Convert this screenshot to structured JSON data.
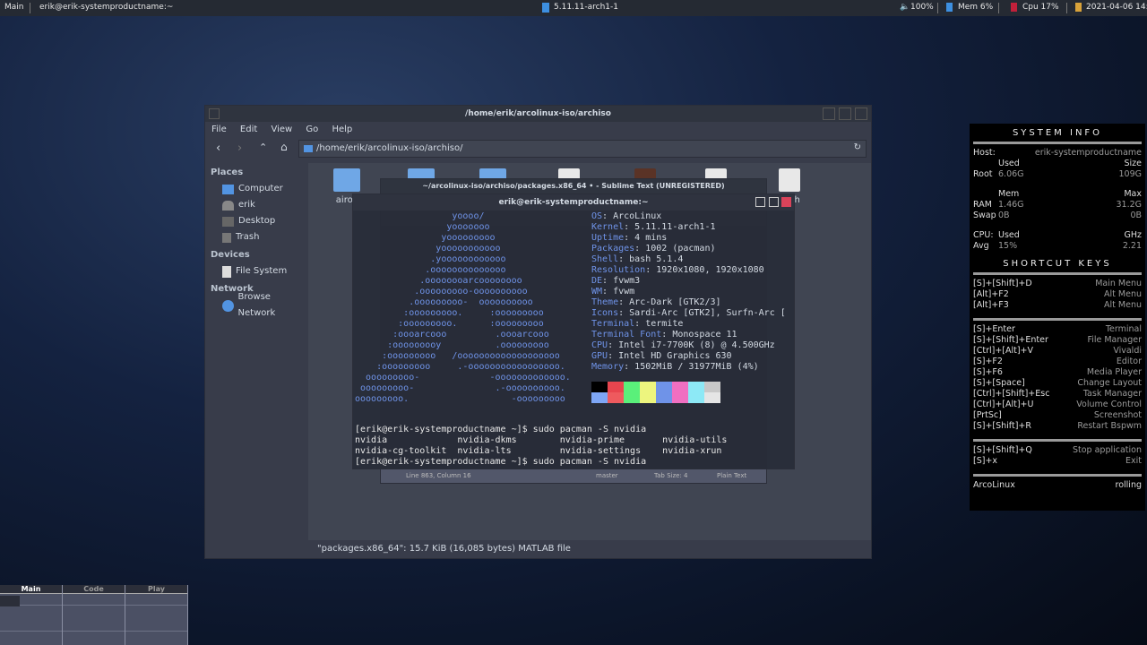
{
  "topbar": {
    "workspace": "Main",
    "window_title": "erik@erik-systemproductname:~",
    "kernel": "5.11.11-arch1-1",
    "volume": "100%",
    "mem": "Mem 6%",
    "cpu": "Cpu  17%",
    "datetime": "2021-04-06 14:06"
  },
  "file_manager": {
    "title": "/home/erik/arcolinux-iso/archiso",
    "menu": [
      "File",
      "Edit",
      "View",
      "Go",
      "Help"
    ],
    "path": "/home/erik/arcolinux-iso/archiso/",
    "sidebar": {
      "places_header": "Places",
      "places": [
        "Computer",
        "erik",
        "Desktop",
        "Trash"
      ],
      "devices_header": "Devices",
      "devices": [
        "File System"
      ],
      "network_header": "Network",
      "network": [
        "Browse Network"
      ]
    },
    "files": [
      {
        "type": "folder",
        "label": "airoc"
      },
      {
        "type": "folder",
        "label": ""
      },
      {
        "type": "folder",
        "label": ""
      },
      {
        "type": "file",
        "label": ""
      },
      {
        "type": "file-brown",
        "label": ""
      },
      {
        "type": "file",
        "label": ""
      },
      {
        "type": "script",
        "label": "ef.sh"
      }
    ],
    "status": "\"packages.x86_64\": 15.7 KiB (16,085 bytes) MATLAB file"
  },
  "sublime": {
    "title": "~/arcolinux-iso/archiso/packages.x86_64 • - Sublime Text (UNREGISTERED)",
    "status_position": "Line 863, Column 16",
    "status_branch": "master",
    "status_tab": "Tab Size: 4",
    "status_syntax": "Plain Text"
  },
  "terminal": {
    "title": "erik@erik-systemproductname:~",
    "ascii": [
      "                  yoooo/",
      "                 yooooooo",
      "                yooooooooo",
      "               yooooooooooo",
      "              .yoooooooooooo",
      "             .oooooooooooooo",
      "            .oooooooarcoooooooo",
      "           .ooooooooo-oooooooooo",
      "          .ooooooooo-  oooooooooo",
      "         :ooooooooo.     :ooooooooo",
      "        :ooooooooo.      :ooooooooo",
      "       :oooarcooo         .oooarcooo",
      "      :ooooooooy          .ooooooooo",
      "     :ooooooooo   /ooooooooooooooooooo",
      "    :ooooooooo     .-ooooooooooooooooo.",
      "  ooooooooo-             -ooooooooooooo.",
      " ooooooooo-               .-oooooooooo.",
      "ooooooooo.                   -ooooooooo"
    ],
    "info": [
      {
        "k": "OS",
        "v": "ArcoLinux"
      },
      {
        "k": "Kernel",
        "v": "5.11.11-arch1-1"
      },
      {
        "k": "Uptime",
        "v": "4 mins"
      },
      {
        "k": "Packages",
        "v": "1002 (pacman)"
      },
      {
        "k": "Shell",
        "v": "bash 5.1.4"
      },
      {
        "k": "Resolution",
        "v": "1920x1080, 1920x1080"
      },
      {
        "k": "DE",
        "v": "fvwm3"
      },
      {
        "k": "WM",
        "v": "fvwm"
      },
      {
        "k": "Theme",
        "v": "Arc-Dark [GTK2/3]"
      },
      {
        "k": "Icons",
        "v": "Sardi-Arc [GTK2], Surfn-Arc ["
      },
      {
        "k": "Terminal",
        "v": "termite"
      },
      {
        "k": "Terminal Font",
        "v": "Monospace 11"
      },
      {
        "k": "CPU",
        "v": "Intel i7-7700K (8) @ 4.500GHz"
      },
      {
        "k": "GPU",
        "v": "Intel HD Graphics 630"
      },
      {
        "k": "Memory",
        "v": "1502MiB / 31977MiB (4%)"
      }
    ],
    "palette_top": [
      "#000000",
      "#e8454e",
      "#5af07a",
      "#edf57e",
      "#6f93e8",
      "#f06fc1",
      "#8de9f6",
      "#c8c8c8"
    ],
    "palette_bottom": [
      "#7ea6f5",
      "#ee5a5e",
      "#5af07a",
      "#edf57e",
      "#6f93e8",
      "#f06fc1",
      "#8de9f6",
      "#e5e5e5"
    ],
    "lines": [
      "[erik@erik-systemproductname ~]$ sudo pacman -S nvidia",
      "nvidia             nvidia-dkms        nvidia-prime       nvidia-utils",
      "nvidia-cg-toolkit  nvidia-lts         nvidia-settings    nvidia-xrun",
      "[erik@erik-systemproductname ~]$ sudo pacman -S nvidia"
    ]
  },
  "conky": {
    "title": "SYSTEM INFO",
    "host_label": "Host:",
    "host": "erik-systemproductname",
    "rows": [
      [
        "",
        "Used",
        "Size"
      ],
      [
        "Root",
        "6.06G",
        "109G"
      ],
      null,
      [
        "",
        "Mem",
        "Max"
      ],
      [
        "RAM",
        "1.46G",
        "31.2G"
      ],
      [
        "Swap",
        "0B",
        "0B"
      ],
      null,
      [
        "CPU:",
        "Used",
        "GHz"
      ],
      [
        "Avg",
        "  15%",
        "2.21"
      ]
    ],
    "shortcuts_title": "SHORTCUT KEYS",
    "groups": [
      [
        [
          "[S]+[Shift]+D",
          "Main Menu"
        ],
        [
          "[Alt]+F2",
          "Alt Menu"
        ],
        [
          "[Alt]+F3",
          "Alt Menu"
        ]
      ],
      [
        [
          "[S]+Enter",
          "Terminal"
        ],
        [
          "[S]+[Shift]+Enter",
          "File Manager"
        ],
        [
          "[Ctrl]+[Alt]+V",
          "Vivaldi"
        ],
        [
          "[S]+F2",
          "Editor"
        ],
        [
          "[S]+F6",
          "Media Player"
        ],
        [
          "[S]+[Space]",
          "Change Layout"
        ],
        [
          "[Ctrl]+[Shift]+Esc",
          "Task Manager"
        ],
        [
          "[Ctrl]+[Alt]+U",
          "Volume Control"
        ],
        [
          "[PrtSc]",
          "Screenshot"
        ],
        [
          "[S]+[Shift]+R",
          "Restart Bspwm"
        ]
      ],
      [
        [
          "[S]+[Shift]+Q",
          "Stop application"
        ],
        [
          "[S]+x",
          "Exit"
        ]
      ]
    ],
    "distro": "ArcoLinux",
    "release": "rolling"
  },
  "pager": {
    "desks": [
      "Main",
      "Code",
      "Play"
    ]
  },
  "colors": {
    "accent": "#5294e2",
    "terminal_blue": "#6f93e8"
  }
}
